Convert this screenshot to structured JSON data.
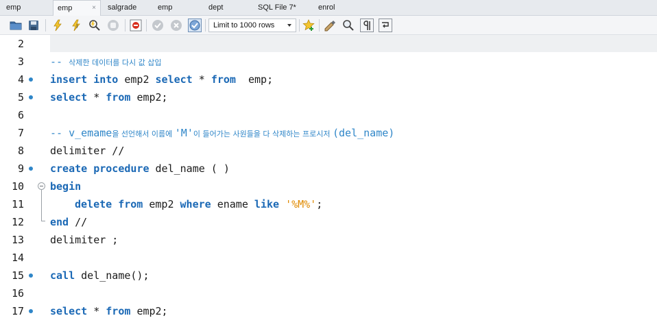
{
  "tabs": [
    {
      "label": "emp",
      "active": false
    },
    {
      "label": "emp",
      "active": true
    },
    {
      "label": "salgrade",
      "active": false
    },
    {
      "label": "emp",
      "active": false
    },
    {
      "label": "dept",
      "active": false
    },
    {
      "label": "SQL File 7*",
      "active": false
    },
    {
      "label": "enrol",
      "active": false
    }
  ],
  "tab_close_glyph": "×",
  "toolbar": {
    "limit_select_value": "Limit to 1000 rows",
    "icons": [
      "open-folder-icon",
      "save-icon",
      "execute-icon",
      "execute-current-icon",
      "explain-icon",
      "stop-icon",
      "toggle-error-icon",
      "commit-icon",
      "rollback-icon",
      "autocommit-icon",
      "add-snippet-icon",
      "beautify-icon",
      "find-icon",
      "invisible-chars-icon",
      "word-wrap-icon"
    ]
  },
  "colors": {
    "keyword": "#1a68b5",
    "comment": "#2f86c8",
    "string": "#e08a00",
    "marker": "#2f86c8"
  },
  "editor": {
    "lines": [
      {
        "num": "2"
      },
      {
        "num": "3",
        "comment": "-- ",
        "comment_small": "삭제한 데이터를 다시 값 삽입"
      },
      {
        "num": "4",
        "kw1": "insert into ",
        "t1": "emp2 ",
        "kw2": "select ",
        "t2": "* ",
        "kw3": "from ",
        "t3": " emp;"
      },
      {
        "num": "5",
        "kw1": "select ",
        "t1": "* ",
        "kw2": "from ",
        "t2": "emp2;"
      },
      {
        "num": "6"
      },
      {
        "num": "7",
        "c1": "-- v_emame",
        "c1_small": "을 선언해서 이름에 ",
        "c2": "'M'",
        "c2_small": "이 들어가는 사원들을 다 삭제하는 프로시저 ",
        "c3": "(del_name)"
      },
      {
        "num": "8",
        "t1": "delimiter //"
      },
      {
        "num": "9",
        "kw1": "create procedure ",
        "t1": "del_name ( )"
      },
      {
        "num": "10",
        "kw1": "begin"
      },
      {
        "num": "11",
        "kw1": "delete from ",
        "t1": "emp2 ",
        "kw2": "where ",
        "t2": "ename ",
        "kw3": "like ",
        "str": "'%M%'",
        "t3": ";"
      },
      {
        "num": "12",
        "kw1": "end ",
        "t1": "//"
      },
      {
        "num": "13",
        "t1": "delimiter ;"
      },
      {
        "num": "14"
      },
      {
        "num": "15",
        "kw1": "call ",
        "t1": "del_name();"
      },
      {
        "num": "16"
      },
      {
        "num": "17",
        "kw1": "select ",
        "t1": "* ",
        "kw2": "from ",
        "t2": "emp2;"
      }
    ]
  }
}
